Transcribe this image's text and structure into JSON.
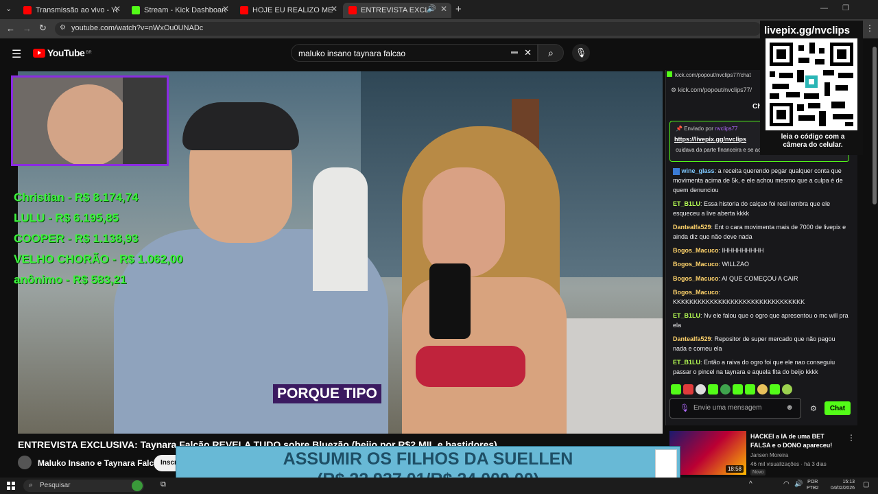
{
  "browser": {
    "tabs": [
      {
        "label": "Transmissão ao vivo - YouTube",
        "favicon_color": "#ff0000"
      },
      {
        "label": "Stream - Kick Dashboard",
        "favicon_color": "#53fc18"
      },
      {
        "label": "HOJE EU REALIZO MEU SONHO",
        "favicon_color": "#ff0000"
      },
      {
        "label": "ENTREVISTA EXCLUSIVA: Tay",
        "favicon_color": "#ff0000"
      }
    ],
    "url": "youtube.com/watch?v=nWxOu0UNADc"
  },
  "youtube": {
    "logo": "YouTube",
    "region": "BR",
    "search_query": "maluko insano taynara falcao"
  },
  "video": {
    "caption": "PORQUE TIPO",
    "donations": [
      "Christian - R$ 8.174,74",
      "LULU - R$ 6.195,85",
      "COOPER - R$ 1.138,93",
      "VELHO CHORÃO - R$ 1.062,00",
      "anônimo - R$ 583,21"
    ],
    "title": "ENTREVISTA EXCLUSIVA: Taynara Falcão REVELA TUDO sobre Bluezão (beijo por R$2 MIL e bastidores)",
    "channel": "Maluko Insano e Taynara Falcão",
    "subscribe_label": "Inscr"
  },
  "chat": {
    "popout_url": "kick.com/popout/nvclips77/chat",
    "popout_url_short": "kick.com/popout/nvclips77/",
    "header": "Ch",
    "pinned": {
      "by_label": "Enviado por",
      "by_user": "nvclips77",
      "link": "https://livepix.gg/nvclips"
    },
    "cut_line": "cuidava da parte financeira e se acertava com o governo",
    "messages": [
      {
        "user": "wine_glass",
        "text": "a receita querendo pegar qualquer conta que movimenta acima de 5k, e ele achou mesmo que a culpa é de quem denunciou"
      },
      {
        "user": "ET_B1LU",
        "text": "Essa historia do calçao foi real lembra que ele esqueceu a live aberta kkkk"
      },
      {
        "user": "Dantealfa529",
        "text": "Ent o cara movimenta mais de 7000 de livepix e ainda diz que não deve nada"
      },
      {
        "user": "Bogos_Macuco",
        "text": "IHHHHHHHHH"
      },
      {
        "user": "Bogos_Macuco",
        "text": "WILLZAO"
      },
      {
        "user": "Bogos_Macuco",
        "text": "AI QUE COMEÇOU A CAIR"
      },
      {
        "user": "Bogos_Macuco",
        "text": "KKKKKKKKKKKKKKKKKKKKKKKKKKKKKKKK"
      },
      {
        "user": "ET_B1LU",
        "text": "Nv ele falou que o ogro que apresentou o mc will pra ela"
      },
      {
        "user": "Dantealfa529",
        "text": "Repositor de super mercado que não pagou nada e comeu ela"
      },
      {
        "user": "ET_B1LU",
        "text": "Então a raiva do ogro foi que ele nao conseguiu passar o pincel na taynara e aquela fita do beijo kkkk"
      }
    ],
    "input_placeholder": "Envie uma mensagem",
    "send_label": "Chat"
  },
  "qr_overlay": {
    "title": "livepix.gg/nvclips",
    "subtitle": "leia o código com a câmera do celular."
  },
  "recommendation": {
    "title": "HACKEI a IA de uma BET FALSA e o DONO apareceu!",
    "channel": "Jansen Moreira",
    "meta": "46 mil visualizações · há 3 dias",
    "badge": "Novo",
    "duration": "18:58"
  },
  "banner": {
    "line1": "ASSUMIR OS FILHOS DA SUELLEN",
    "line2": "(R$ 22.937,01/R$ 24.000,00)"
  },
  "taskbar": {
    "search_label": "Pesquisar",
    "lang": "POR",
    "layout": "PTB2",
    "time": "15:13",
    "date": "04/02/2026"
  }
}
